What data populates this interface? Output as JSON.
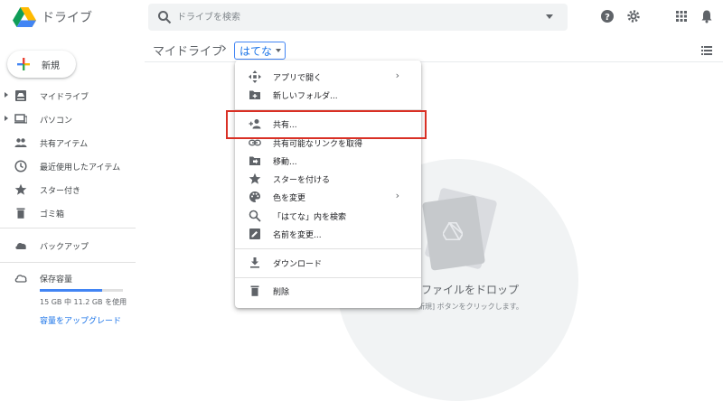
{
  "app": {
    "title": "ドライブ"
  },
  "search": {
    "placeholder": "ドライブを検索"
  },
  "breadcrumb": {
    "root": "マイドライブ",
    "separator": "›",
    "current": "はてな"
  },
  "new_button": {
    "label": "新規"
  },
  "sidebar": {
    "items": [
      {
        "label": "マイドライブ",
        "icon": "my-drive-icon",
        "expandable": true
      },
      {
        "label": "パソコン",
        "icon": "computers-icon",
        "expandable": true
      },
      {
        "label": "共有アイテム",
        "icon": "shared-with-me-icon",
        "expandable": false
      },
      {
        "label": "最近使用したアイテム",
        "icon": "recent-icon",
        "expandable": false
      },
      {
        "label": "スター付き",
        "icon": "star-icon",
        "expandable": false
      },
      {
        "label": "ゴミ箱",
        "icon": "trash-icon",
        "expandable": false
      }
    ],
    "backup": {
      "label": "バックアップ",
      "icon": "cloud-icon"
    },
    "storage": {
      "label": "保存容量",
      "icon": "cloud-outline-icon",
      "usage_text": "15 GB 中 11.2 GB を使用",
      "used_fraction": 0.75,
      "upgrade_label": "容量をアップグレード"
    }
  },
  "context_menu": {
    "items": [
      {
        "label": "アプリで開く",
        "icon": "open-with-icon",
        "submenu": true
      },
      {
        "label": "新しいフォルダ...",
        "icon": "new-folder-icon",
        "submenu": false
      },
      {
        "label": "共有...",
        "icon": "share-person-icon",
        "submenu": false,
        "highlighted": true
      },
      {
        "label": "共有可能なリンクを取得",
        "icon": "link-icon",
        "submenu": false
      },
      {
        "label": "移動...",
        "icon": "move-folder-icon",
        "submenu": false
      },
      {
        "label": "スターを付ける",
        "icon": "star-icon",
        "submenu": false
      },
      {
        "label": "色を変更",
        "icon": "palette-icon",
        "submenu": true
      },
      {
        "label": "「はてな」内を検索",
        "icon": "search-icon",
        "submenu": false
      },
      {
        "label": "名前を変更...",
        "icon": "rename-icon",
        "submenu": false
      },
      {
        "label": "ダウンロード",
        "icon": "download-icon",
        "submenu": false
      },
      {
        "label": "削除",
        "icon": "trash-icon",
        "submenu": false
      }
    ],
    "submenu_glyph": "›"
  },
  "empty_state": {
    "title": "ファイルをドロップ",
    "subtitle": "新規] ボタンをクリックします。"
  },
  "colors": {
    "accent": "#1a73e8",
    "highlight_border": "#d93025",
    "drive_green": "#0f9d58",
    "drive_yellow": "#f4b400",
    "drive_blue": "#4285f4"
  }
}
